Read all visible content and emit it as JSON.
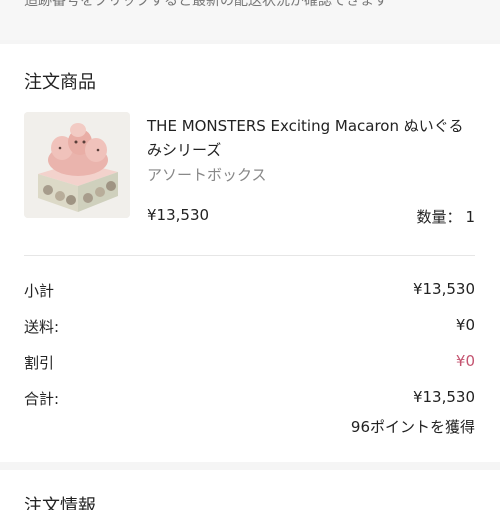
{
  "tracking_note": "追跡番号をクリックすると最新の配送状況が確認できます",
  "order_items": {
    "title": "注文商品",
    "product": {
      "name": "THE MONSTERS Exciting Macaron ぬいぐるみシリーズ",
      "variant": "アソートボックス",
      "price": "¥13,530",
      "qty_label": "数量：",
      "qty_value": "1"
    }
  },
  "summary": {
    "subtotal_label": "小計",
    "subtotal_value": "¥13,530",
    "shipping_label": "送料:",
    "shipping_value": "¥0",
    "discount_label": "割引",
    "discount_value": "¥0",
    "total_label": "合計:",
    "total_value": "¥13,530",
    "points_text": "96ポイントを獲得"
  },
  "next_section_title": "注文情報",
  "colors": {
    "discount": "#c45470",
    "page_background": "#f5f5f5",
    "card_background": "#ffffff"
  }
}
